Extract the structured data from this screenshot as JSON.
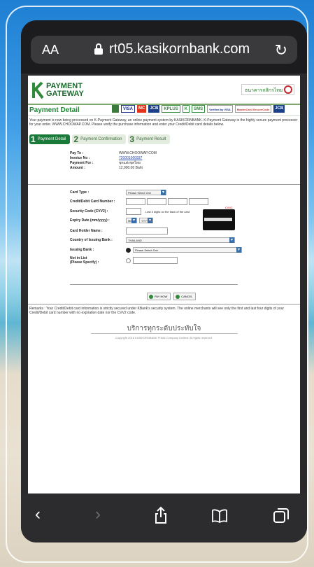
{
  "browser": {
    "text_size_label": "AA",
    "url": "rt05.kasikornbank.com",
    "reload_icon": "reload-icon",
    "lock_icon": "lock-icon"
  },
  "header": {
    "logo_line1": "PAYMENT",
    "logo_line2": "GATEWAY",
    "bank_logo_text": "ธนาคารกสิกรไทย",
    "title": "Payment Detail",
    "card_brands": [
      "VISA",
      "MC",
      "JCB",
      "KPLUS",
      "K",
      "SMS",
      "Verified by VISA",
      "MasterCard SecureCode",
      "JCB"
    ]
  },
  "intro_text": "Your payment is now being processed on K-Payment Gateway, an online payment system by KASIKORNBANK. K-Payment Gateway is the highly secure payment processor for your order. WWW.CHOOWAP.COM. Please verify the purchase information and enter your Credit/Debit card details below.",
  "steps": [
    {
      "num": "1",
      "label": "Payment Detail"
    },
    {
      "num": "2",
      "label": "Payment Confirmation"
    },
    {
      "num": "3",
      "label": "Payment Result"
    }
  ],
  "info": {
    "pay_to_label": "Pay To :",
    "pay_to_value": "WWW.CHOOWAP.COM",
    "invoice_label": "Invoice No :",
    "invoice_value": "720001000937",
    "payment_for_label": "Payment For :",
    "payment_for_value": "ชุดแต่งชุดไทย",
    "amount_label": "Amount :",
    "amount_value": "12,900.00 Baht"
  },
  "form": {
    "card_type_label": "Card Type :",
    "card_type_value": "Please Select One",
    "card_number_label": "Credit/Debit Card Number :",
    "cvv_label": "Security Code (CVV2) :",
    "cvv_hint": "Last 3 digits on the back of the card",
    "cvv_card_label": "CVV2",
    "expiry_label": "Expiry Date (mm/yyyy) :",
    "expiry_month": "MM",
    "expiry_year": "YYYY",
    "holder_label": "Card Holder Name :",
    "country_label": "Country of Issuing Bank :",
    "country_value": "THAILAND",
    "issuing_bank_label": "Issuing Bank :",
    "issuing_bank_value": "Please Select One",
    "not_in_list_label": "Not in List",
    "not_in_list_sub": "(Please Specify) :",
    "pay_now": "PAY NOW",
    "cancel": "CANCEL"
  },
  "remarks": "Remarks : Your Credit/Debit card information is strictly secured under KBank's security system. The online merchants will see only the first and last four digits of your Credit/Debit card number with no expiration date nor the CVV2 code.",
  "slogan": "บริการทุกระดับประทับใจ",
  "copyright": "Copyright 2016 KASIKORNBANK Public Company Limited. All rights reserved."
}
